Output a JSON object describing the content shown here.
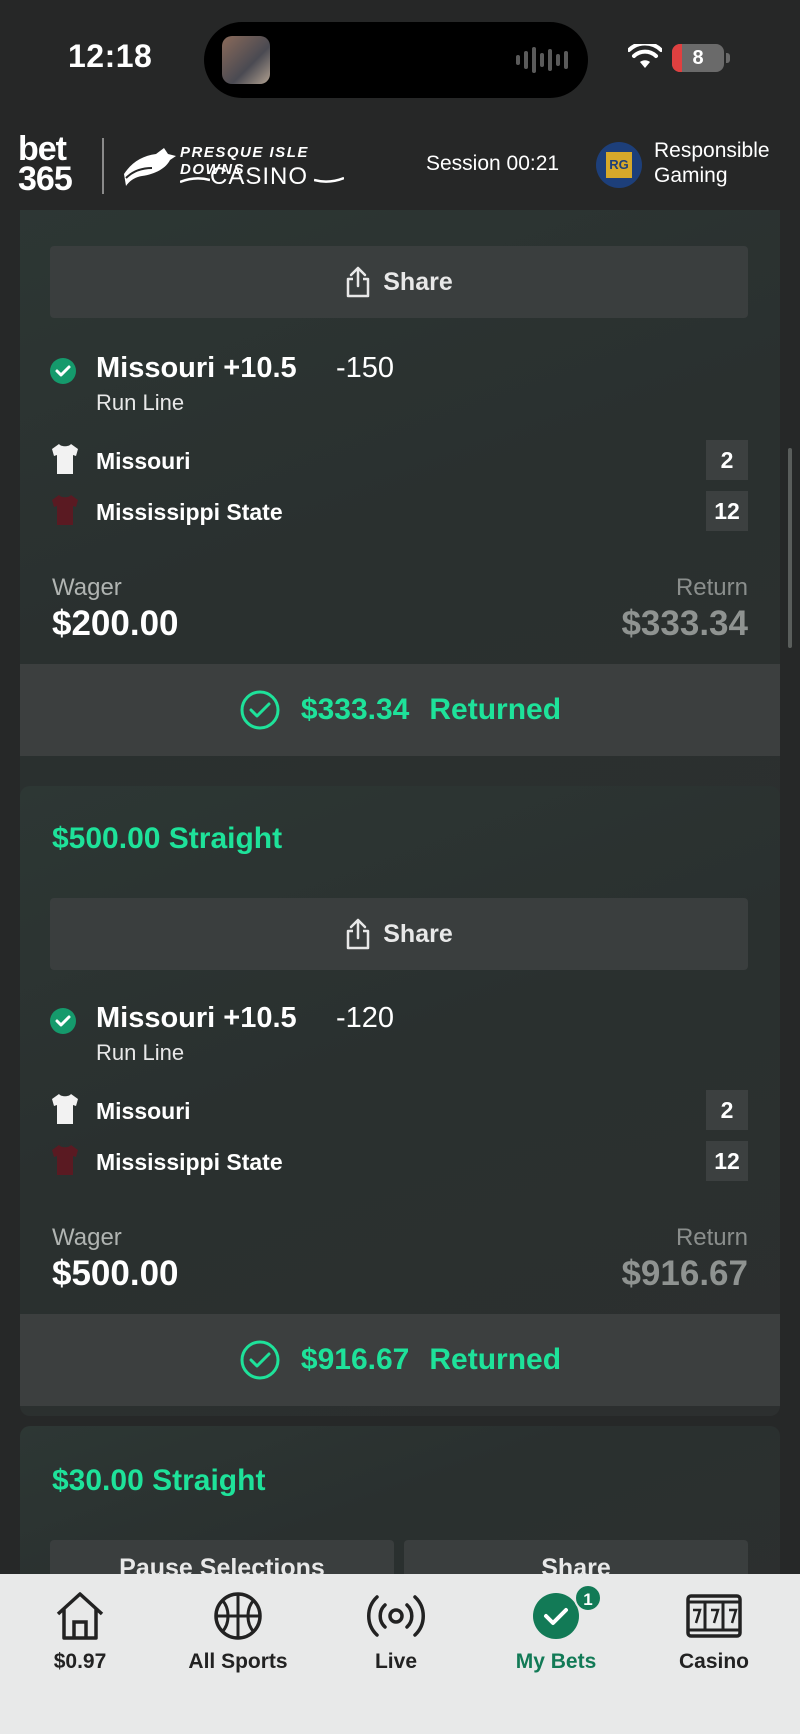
{
  "status_bar": {
    "time": "12:18",
    "battery": "8"
  },
  "header": {
    "brand_line1": "bet",
    "brand_line2": "365",
    "casino_top": "PRESQUE ISLE DOWNS",
    "casino_bottom": "CASINO",
    "session": "Session 00:21",
    "rg_badge": "RG",
    "responsible_gaming": "Responsible Gaming"
  },
  "bets": [
    {
      "title": "",
      "share_label": "Share",
      "selection": {
        "name": "Missouri +10.5",
        "odds": "-150",
        "market": "Run Line"
      },
      "teams": [
        {
          "name": "Missouri",
          "score": "2",
          "jersey_color": "#f2f2f2"
        },
        {
          "name": "Mississippi State",
          "score": "12",
          "jersey_color": "#5a1a22"
        }
      ],
      "wager_label": "Wager",
      "wager": "$200.00",
      "return_label": "Return",
      "return": "$333.34",
      "returned_amount": "$333.34",
      "returned_word": "Returned"
    },
    {
      "title": "$500.00 Straight",
      "share_label": "Share",
      "selection": {
        "name": "Missouri +10.5",
        "odds": "-120",
        "market": "Run Line"
      },
      "teams": [
        {
          "name": "Missouri",
          "score": "2",
          "jersey_color": "#f2f2f2"
        },
        {
          "name": "Mississippi State",
          "score": "12",
          "jersey_color": "#5a1a22"
        }
      ],
      "wager_label": "Wager",
      "wager": "$500.00",
      "return_label": "Return",
      "return": "$916.67",
      "returned_amount": "$916.67",
      "returned_word": "Returned"
    },
    {
      "title": "$30.00 Straight",
      "pause_label": "Pause Selections",
      "share_label": "Share"
    }
  ],
  "bottom_nav": [
    {
      "label": "$0.97",
      "icon": "home-icon"
    },
    {
      "label": "All Sports",
      "icon": "basketball-icon"
    },
    {
      "label": "Live",
      "icon": "live-broadcast-icon"
    },
    {
      "label": "My Bets",
      "icon": "check-circle-icon",
      "badge": "1",
      "active": true
    },
    {
      "label": "Casino",
      "icon": "slot-machine-icon"
    }
  ],
  "colors": {
    "accent": "#1ee29a",
    "active_nav": "#127a56",
    "background": "#262828"
  }
}
